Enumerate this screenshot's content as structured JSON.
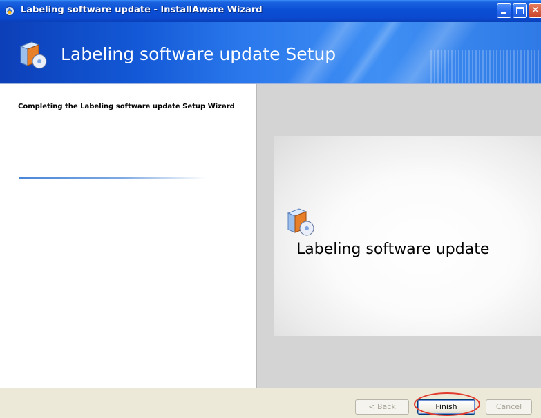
{
  "window": {
    "title": "Labeling software update - InstallAware Wizard",
    "controls": [
      "minimize",
      "maximize",
      "close"
    ]
  },
  "banner": {
    "title": "Labeling software update Setup",
    "icon": "installer-box-icon"
  },
  "left_panel": {
    "heading": "Completing the Labeling software update Setup Wizard"
  },
  "right_panel": {
    "product_name": "Labeling software update",
    "icon": "installer-box-icon"
  },
  "buttons": {
    "back_label": "< Back",
    "finish_label": "Finish",
    "cancel_label": "Cancel"
  },
  "colors": {
    "title_bar": "#0a4fd4",
    "highlight_ring": "#e23b2d"
  }
}
